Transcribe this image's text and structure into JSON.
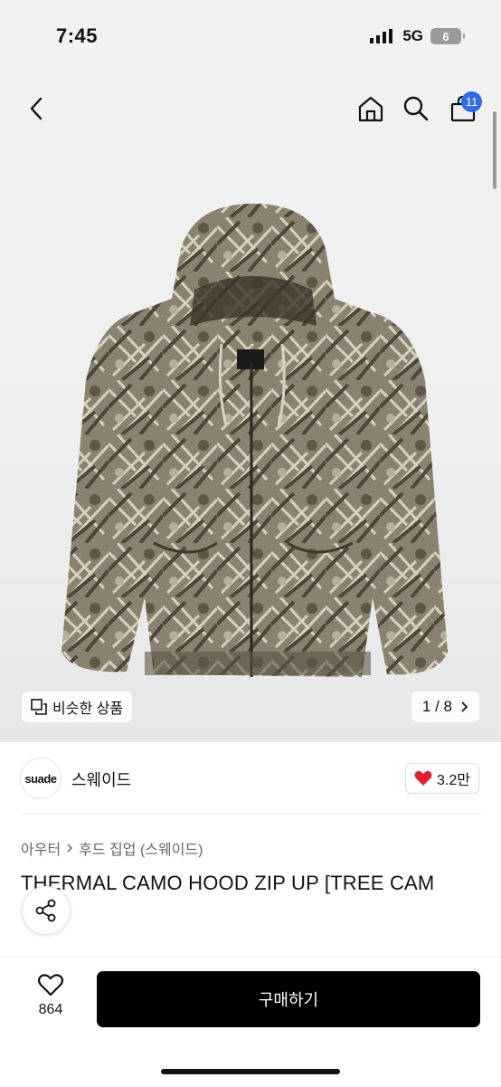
{
  "status_bar": {
    "time": "7:45",
    "network": "5G",
    "battery": "6"
  },
  "nav": {
    "cart_count": "11"
  },
  "gallery": {
    "similar_label": "비슷한 상품",
    "page_indicator": "1 / 8",
    "image_logo": "suade"
  },
  "brand": {
    "logo_text": "suade",
    "name": "스웨이드",
    "likes": "3.2만"
  },
  "breadcrumb": {
    "level1": "아우터",
    "level2": "후드 집업 (스웨이드)"
  },
  "product": {
    "title": "THERMAL CAMO HOOD ZIP UP [TREE CAM"
  },
  "bottom_bar": {
    "wish_count": "864",
    "buy_label": "구매하기"
  },
  "colors": {
    "accent_badge": "#2f6bea",
    "heart": "#e5202e",
    "buy_button": "#000000"
  }
}
